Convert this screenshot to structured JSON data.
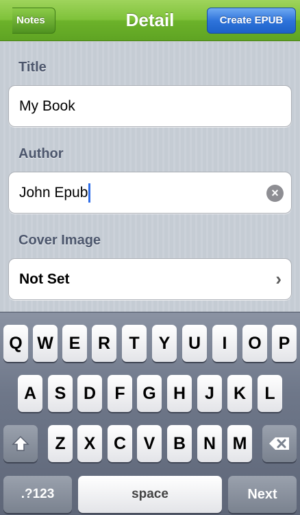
{
  "navbar": {
    "back_label": "Notes",
    "title": "Detail",
    "action_label": "Create EPUB"
  },
  "form": {
    "title_label": "Title",
    "title_value": "My Book",
    "author_label": "Author",
    "author_value": "John Epub",
    "cover_label": "Cover Image",
    "cover_value": "Not Set"
  },
  "icons": {
    "clear": "clear-x-icon",
    "chevron": "chevron-right-icon",
    "shift": "shift-arrow-icon",
    "delete": "backspace-icon"
  },
  "keyboard": {
    "row1": [
      "Q",
      "W",
      "E",
      "R",
      "T",
      "Y",
      "U",
      "I",
      "O",
      "P"
    ],
    "row2": [
      "A",
      "S",
      "D",
      "F",
      "G",
      "H",
      "J",
      "K",
      "L"
    ],
    "row3": [
      "Z",
      "X",
      "C",
      "V",
      "B",
      "N",
      "M"
    ],
    "numbers_label": ".?123",
    "space_label": "space",
    "next_label": "Next"
  },
  "colors": {
    "navbar": "#7fc23a",
    "action_button": "#2f74db",
    "caret": "#2f6ee8"
  }
}
